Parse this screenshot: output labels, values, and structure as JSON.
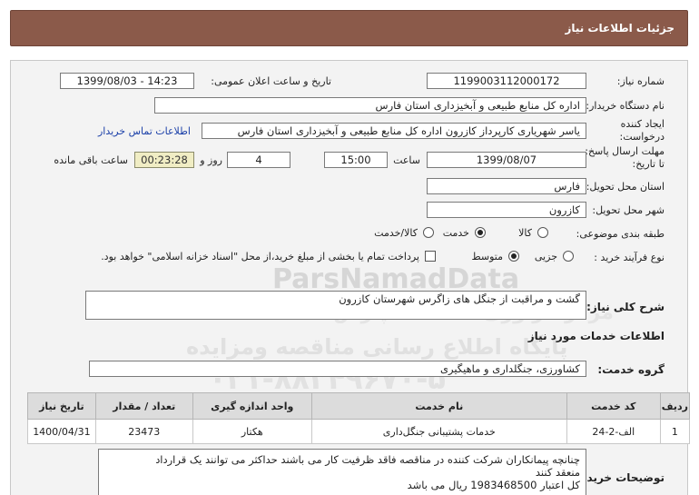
{
  "header": {
    "title": "جزئیات اطلاعات نیاز"
  },
  "labels": {
    "need_number": "شماره نیاز:",
    "announce_datetime": "تاریخ و ساعت اعلان عمومی:",
    "buyer_org": "نام دستگاه خریدار:",
    "requester": "ایجاد کننده درخواست:",
    "deadline": "مهلت ارسال پاسخ: تا تاریخ:",
    "time": "ساعت",
    "day_and": "روز و",
    "remaining": "ساعت باقی مانده",
    "province": "استان محل تحویل:",
    "city": "شهر محل تحویل:",
    "category": "طبقه بندی موضوعی:",
    "purchase_process": "نوع فرآیند خرید :",
    "need_desc": "شرح کلی نیاز:",
    "services_info": "اطلاعات خدمات مورد نیاز",
    "service_group": "گروه خدمت:",
    "buyer_notes": "توضیحات خریدار:"
  },
  "fields": {
    "need_number": "1199003112000172",
    "announce_datetime": "1399/08/03 - 14:23",
    "buyer_org": "اداره کل منابع طبیعی و آبخیزداری استان فارس",
    "requester": "یاسر شهریاری کارپرداز کازرون اداره کل منابع طبیعی و آبخیزداری استان فارس",
    "contact_link": "اطلاعات تماس خریدار",
    "deadline_date": "1399/08/07",
    "deadline_time": "15:00",
    "days": "4",
    "remaining_time": "00:23:28",
    "province": "فارس",
    "city": "کازرون",
    "need_desc": "گشت و مراقبت از جنگل های زاگرس شهرستان کازرون",
    "service_group": "کشاورزی، جنگلداری و ماهیگیری"
  },
  "category_options": {
    "goods": "کالا",
    "service": "خدمت",
    "goods_service": "کالا/خدمت",
    "selected": "خدمت"
  },
  "purchase_options": {
    "partial": "جزیی",
    "medium": "متوسط",
    "selected": "متوسط",
    "treasury_note": "پرداخت تمام یا بخشی از مبلغ خرید،از محل \"اسناد خزانه اسلامی\" خواهد بود.",
    "treasury_checked": false
  },
  "table": {
    "headers": [
      "ردیف",
      "کد خدمت",
      "نام خدمت",
      "واحد اندازه گیری",
      "تعداد / مقدار",
      "تاریخ نیاز"
    ],
    "rows": [
      [
        "1",
        "الف-2-24",
        "خدمات پشتیبانی جنگل‌داری",
        "هکتار",
        "23473",
        "1400/04/31"
      ]
    ]
  },
  "notes_lines": [
    "چنانچه پیمانکاران شرکت کننده در مناقصه فاقد ظرفیت کار می باشند حداکثر می توانند یک قرارداد",
    "منعقد کنند",
    "کل اعتبار 1983468500 ریال می باشد"
  ],
  "watermark": {
    "brand": "ParsNamadData",
    "line1": "مرکز فراوری اطلاعات پارس نماد داده ها",
    "line2": "پایگاه اطلاع رسانی مناقصه ومزایده",
    "phone": "۰۲۱-۸۸۳۴۹۶۷۰-۵"
  }
}
